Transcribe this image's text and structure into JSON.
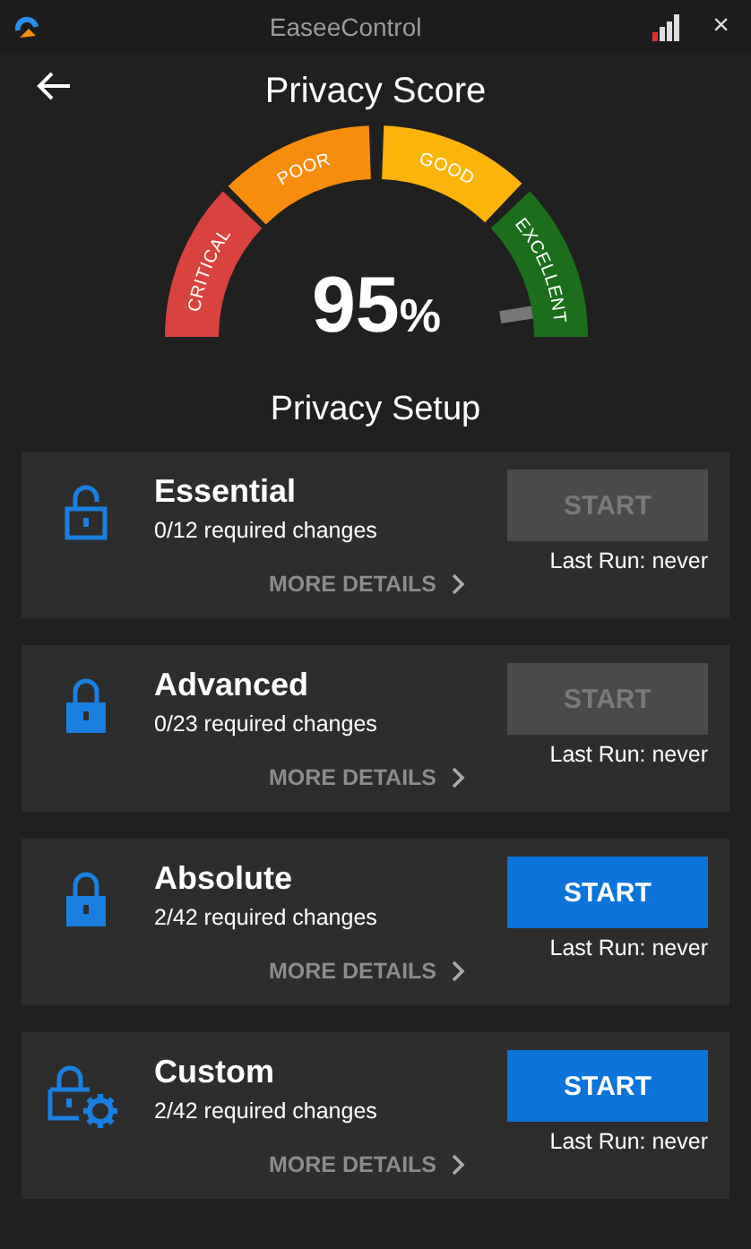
{
  "window": {
    "title": "EaseeControl",
    "close": "×"
  },
  "header": {
    "title": "Privacy Score"
  },
  "gauge": {
    "score": "95",
    "unit": "%",
    "segments": [
      {
        "label": "CRITICAL",
        "color": "#d9423f"
      },
      {
        "label": "POOR",
        "color": "#f68d0c"
      },
      {
        "label": "GOOD",
        "color": "#fbb40a"
      },
      {
        "label": "EXCELLENT",
        "color": "#1c6e1c"
      }
    ]
  },
  "section_title": "Privacy Setup",
  "profiles": [
    {
      "name": "Essential",
      "changes": "0/12 required changes",
      "kind": "open",
      "button": "START",
      "disabled": true,
      "last_run": "Last Run: never",
      "details": "MORE DETAILS"
    },
    {
      "name": "Advanced",
      "changes": "0/23 required changes",
      "kind": "locked",
      "button": "START",
      "disabled": true,
      "last_run": "Last Run: never",
      "details": "MORE DETAILS"
    },
    {
      "name": "Absolute",
      "changes": "2/42 required changes",
      "kind": "locked",
      "button": "START",
      "disabled": false,
      "last_run": "Last Run: never",
      "details": "MORE DETAILS"
    },
    {
      "name": "Custom",
      "changes": "2/42 required changes",
      "kind": "custom",
      "button": "START",
      "disabled": false,
      "last_run": "Last Run: never",
      "details": "MORE DETAILS"
    }
  ]
}
